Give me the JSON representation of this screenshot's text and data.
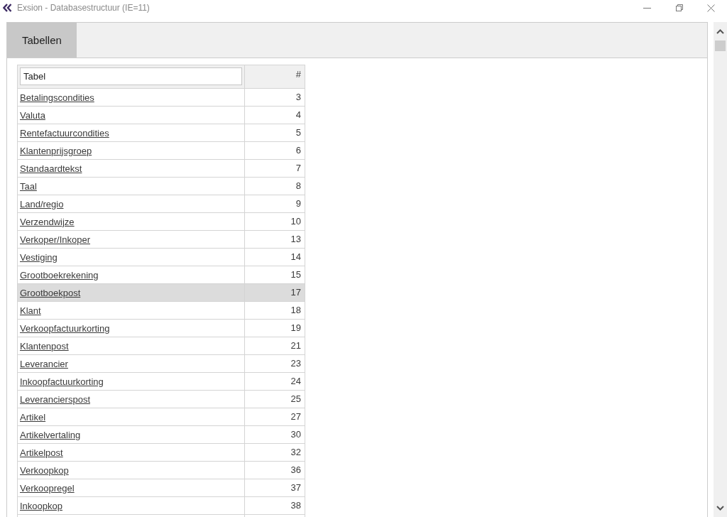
{
  "window": {
    "title": "Exsion - Databasestructuur (IE=11)"
  },
  "tabs": [
    {
      "label": "Tabellen",
      "selected": true
    }
  ],
  "table": {
    "filter_field": {
      "placeholder": "Tabel"
    },
    "number_header": "#",
    "rows": [
      {
        "name": "Betalingscondities",
        "number": "3",
        "selected": false
      },
      {
        "name": "Valuta",
        "number": "4",
        "selected": false
      },
      {
        "name": "Rentefactuurcondities",
        "number": "5",
        "selected": false
      },
      {
        "name": "Klantenprijsgroep",
        "number": "6",
        "selected": false
      },
      {
        "name": "Standaardtekst",
        "number": "7",
        "selected": false
      },
      {
        "name": "Taal",
        "number": "8",
        "selected": false
      },
      {
        "name": "Land/regio",
        "number": "9",
        "selected": false
      },
      {
        "name": "Verzendwijze",
        "number": "10",
        "selected": false
      },
      {
        "name": "Verkoper/Inkoper",
        "number": "13",
        "selected": false
      },
      {
        "name": "Vestiging",
        "number": "14",
        "selected": false
      },
      {
        "name": "Grootboekrekening",
        "number": "15",
        "selected": false
      },
      {
        "name": "Grootboekpost",
        "number": "17",
        "selected": true
      },
      {
        "name": "Klant",
        "number": "18",
        "selected": false
      },
      {
        "name": "Verkoopfactuurkorting",
        "number": "19",
        "selected": false
      },
      {
        "name": "Klantenpost",
        "number": "21",
        "selected": false
      },
      {
        "name": "Leverancier",
        "number": "23",
        "selected": false
      },
      {
        "name": "Inkoopfactuurkorting",
        "number": "24",
        "selected": false
      },
      {
        "name": "Leverancierspost",
        "number": "25",
        "selected": false
      },
      {
        "name": "Artikel",
        "number": "27",
        "selected": false
      },
      {
        "name": "Artikelvertaling",
        "number": "30",
        "selected": false
      },
      {
        "name": "Artikelpost",
        "number": "32",
        "selected": false
      },
      {
        "name": "Verkoopkop",
        "number": "36",
        "selected": false
      },
      {
        "name": "Verkoopregel",
        "number": "37",
        "selected": false
      },
      {
        "name": "Inkoopkop",
        "number": "38",
        "selected": false
      }
    ]
  }
}
